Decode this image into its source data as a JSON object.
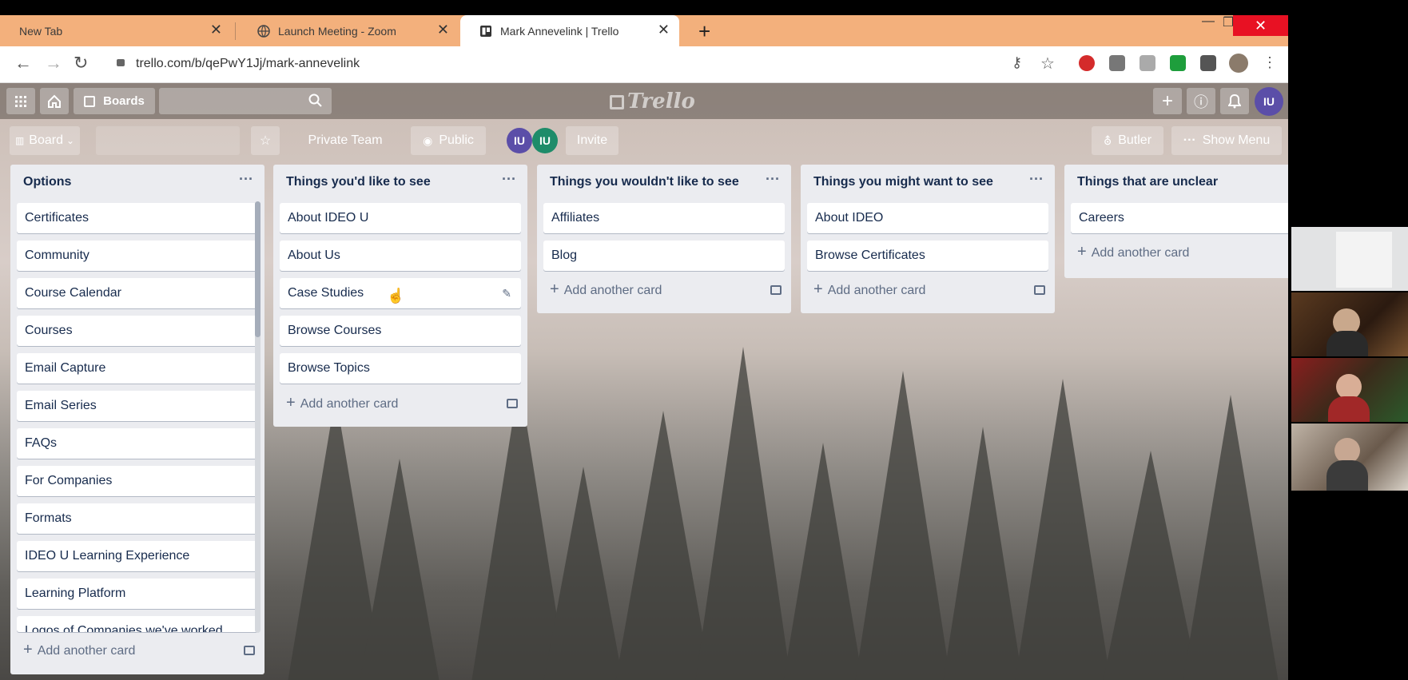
{
  "browser": {
    "tabs": [
      {
        "label": "New Tab"
      },
      {
        "label": "Launch Meeting - Zoom"
      },
      {
        "label": "Mark Annevelink | Trello"
      }
    ],
    "url": "trello.com/b/qePwY1Jj/mark-annevelink"
  },
  "trello": {
    "header": {
      "boards_label": "Boards",
      "logo": "Trello",
      "user_initials": "IU"
    },
    "board_bar": {
      "board_label": "Board",
      "team_label": "Private Team",
      "visibility_label": "Public",
      "invite_label": "Invite",
      "butler_label": "Butler",
      "show_menu_label": "Show Menu",
      "member_initials": [
        "IU",
        "IU"
      ]
    },
    "add_card_label": "Add another card",
    "lists": [
      {
        "title": "Options",
        "cards": [
          "Certificates",
          "Community",
          "Course Calendar",
          "Courses",
          "Email Capture",
          "Email Series",
          "FAQs",
          "For Companies",
          "Formats",
          "IDEO U Learning Experience",
          "Learning Platform",
          "Logos of Companies we've worked"
        ]
      },
      {
        "title": "Things you'd like to see",
        "cards": [
          "About IDEO U",
          "About Us",
          "Case Studies",
          "Browse Courses",
          "Browse Topics"
        ]
      },
      {
        "title": "Things you wouldn't like to see",
        "cards": [
          "Affiliates",
          "Blog"
        ]
      },
      {
        "title": "Things you might want to see",
        "cards": [
          "About IDEO",
          "Browse Certificates"
        ]
      },
      {
        "title": "Things that are unclear",
        "cards": [
          "Careers"
        ]
      }
    ]
  },
  "colors": {
    "tab_strip": "#f3b07c",
    "list_bg": "#ebecf0",
    "avatar_purple": "#5b4ea8",
    "avatar_green": "#1e8c6a"
  }
}
